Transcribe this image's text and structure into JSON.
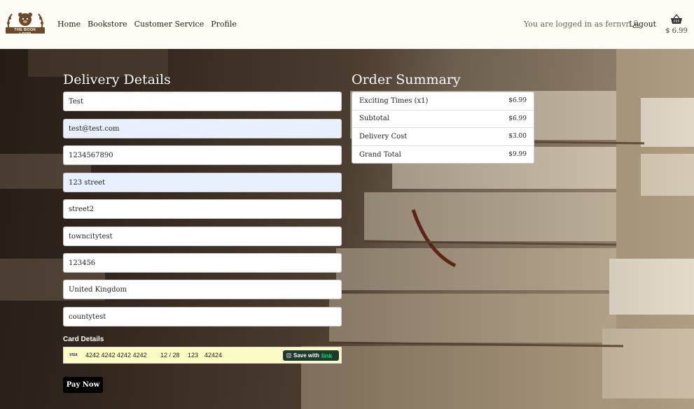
{
  "nav": {
    "logo_text": "THE BOOK LOOP",
    "links": [
      "Home",
      "Bookstore",
      "Customer Service",
      "Profile"
    ],
    "login_status": "You are logged in as fernvr",
    "logout": "Logout",
    "cart_total": "$ 6.99"
  },
  "delivery": {
    "heading": "Delivery Details",
    "fields": [
      {
        "value": "Test"
      },
      {
        "value": "test@test.com"
      },
      {
        "value": "1234567890"
      },
      {
        "value": "123 street"
      },
      {
        "value": "street2"
      },
      {
        "value": "towncitytest"
      },
      {
        "value": "123456"
      },
      {
        "value": "United Kingdom"
      },
      {
        "value": "countytest"
      }
    ]
  },
  "card": {
    "label": "Card Details",
    "brand": "VISA",
    "number": "4242 4242 4242 4242",
    "expiry": "12 / 28",
    "cvc": "123",
    "zip": "42424",
    "link_label": "Save with",
    "link_brand": "link"
  },
  "pay_button": "Pay Now",
  "summary": {
    "heading": "Order Summary",
    "rows": [
      {
        "label": "Exciting Times (x1)",
        "amount": "$6.99"
      },
      {
        "label": "Subtotal",
        "amount": "$6.99"
      },
      {
        "label": "Delivery Cost",
        "amount": "$3.00"
      },
      {
        "label": "Grand Total",
        "amount": "$9.99"
      }
    ]
  },
  "colors": {
    "background": "#fffcf5",
    "pay_button": "#000000",
    "autofill": "#e8f0fe",
    "card_row": "#fbfbc4",
    "link_green": "#00d66f"
  }
}
